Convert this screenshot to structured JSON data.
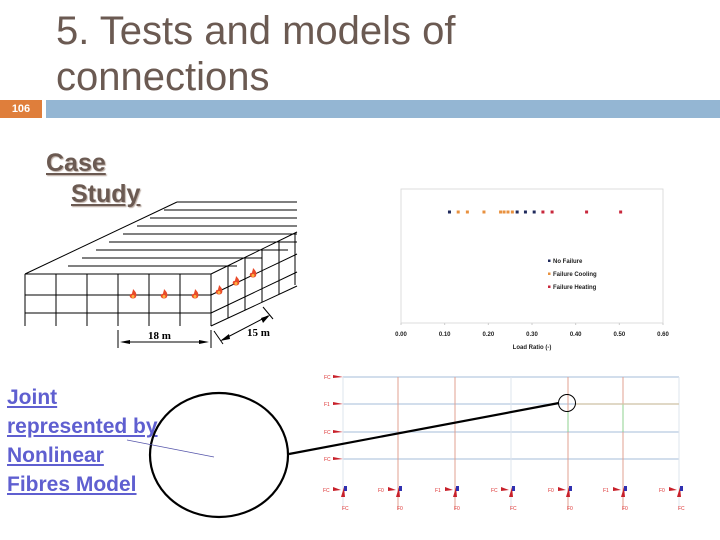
{
  "slide": {
    "number": "106",
    "title_line1": "5. Tests and models of",
    "title_line2": "connections",
    "case_study_line1": "Case",
    "case_study_line2": "Study",
    "joint_text": [
      "Joint",
      "represented by",
      "Nonlinear",
      "Fibres Model"
    ],
    "colors": {
      "title": "#6b5a52",
      "badge": "#df7e3b",
      "title_bar": "#94b6d3",
      "joint_text": "#5f5fd0"
    }
  },
  "building_diagram": {
    "dimension_width": "18 m",
    "dimension_depth": "15 m",
    "fire_icon_count": 6
  },
  "chart_data": {
    "type": "scatter",
    "title": "",
    "xlabel": "Load Ratio (-)",
    "ylabel": "",
    "xlim": [
      0.0,
      0.6
    ],
    "xticks": [
      "0.00",
      "0.10",
      "0.20",
      "0.30",
      "0.40",
      "0.50",
      "0.60"
    ],
    "grid": false,
    "legend_position": "center-right",
    "series": [
      {
        "name": "No Failure",
        "color": "#1f2a5c",
        "x": [
          0.111,
          0.266,
          0.285,
          0.305
        ]
      },
      {
        "name": "Failure Cooling",
        "color": "#e8913f",
        "x": [
          0.131,
          0.152,
          0.19,
          0.228,
          0.236,
          0.245,
          0.255
        ]
      },
      {
        "name": "Failure Heating",
        "color": "#c8283c",
        "x": [
          0.325,
          0.346,
          0.425,
          0.503
        ]
      }
    ]
  },
  "frame_model": {
    "floor_labels": [
      "FC",
      "F1",
      "FC",
      "FC"
    ],
    "support_labels_top": [
      "FC",
      "F0",
      "F1",
      "FC",
      "F0",
      "F1",
      "F0"
    ],
    "support_labels_bottom": [
      "FC",
      "F0",
      "F0",
      "FC",
      "F0",
      "F0",
      "FC"
    ]
  }
}
